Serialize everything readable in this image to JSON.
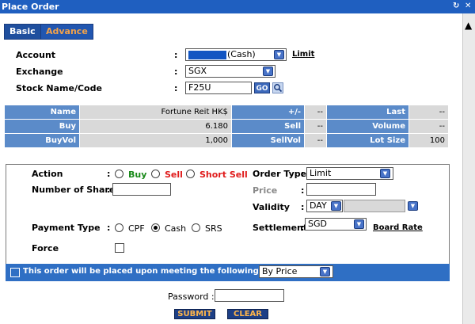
{
  "window": {
    "title": "Place Order",
    "icons": [
      "refresh-icon",
      "close-icon"
    ]
  },
  "tabs": [
    {
      "label": "Basic",
      "active": true
    },
    {
      "label": "Advance",
      "active": false
    }
  ],
  "header_fields": {
    "account": {
      "label": "Account",
      "value": "(Cash)",
      "link": "Limit"
    },
    "exchange": {
      "label": "Exchange",
      "value": "SGX"
    },
    "stock": {
      "label": "Stock Name/Code",
      "value": "F25U",
      "go_label": "GO"
    }
  },
  "info": {
    "row1": {
      "name_label": "Name",
      "name_value": "Fortune Reit HK$",
      "pm_label": "+/-",
      "pm_value": "--",
      "last_label": "Last",
      "last_value": "--"
    },
    "row2": {
      "buy_label": "Buy",
      "buy_value": "6.180",
      "sell_label": "Sell",
      "sell_value": "--",
      "vol_label": "Volume",
      "vol_value": "--"
    },
    "row3": {
      "buyvol_label": "BuyVol",
      "buyvol_value": "1,000",
      "sellvol_label": "SellVol",
      "sellvol_value": "--",
      "lot_label": "Lot Size",
      "lot_value": "100"
    }
  },
  "order": {
    "action_label": "Action",
    "actions": [
      {
        "label": "Buy",
        "color": "#1a8a1a"
      },
      {
        "label": "Sell",
        "color": "#e01b1b"
      },
      {
        "label": "Short Sell",
        "color": "#e01b1b"
      }
    ],
    "shares_label": "Number of Shares",
    "order_type_label": "Order Type",
    "order_type_value": "Limit",
    "price_label": "Price",
    "validity_label": "Validity",
    "validity_value": "DAY",
    "payment_label": "Payment Type",
    "payments": [
      "CPF",
      "Cash",
      "SRS"
    ],
    "payment_selected": "Cash",
    "settlement_label": "Settlement",
    "settlement_value": "SGD",
    "board_rate_label": "Board Rate",
    "force_label": "Force"
  },
  "criteria": {
    "text": "This order will be placed upon meeting the following criteria:",
    "select_value": "By Price"
  },
  "password": {
    "label": "Password :"
  },
  "buttons": {
    "submit": "SUBMIT",
    "clear": "CLEAR"
  }
}
